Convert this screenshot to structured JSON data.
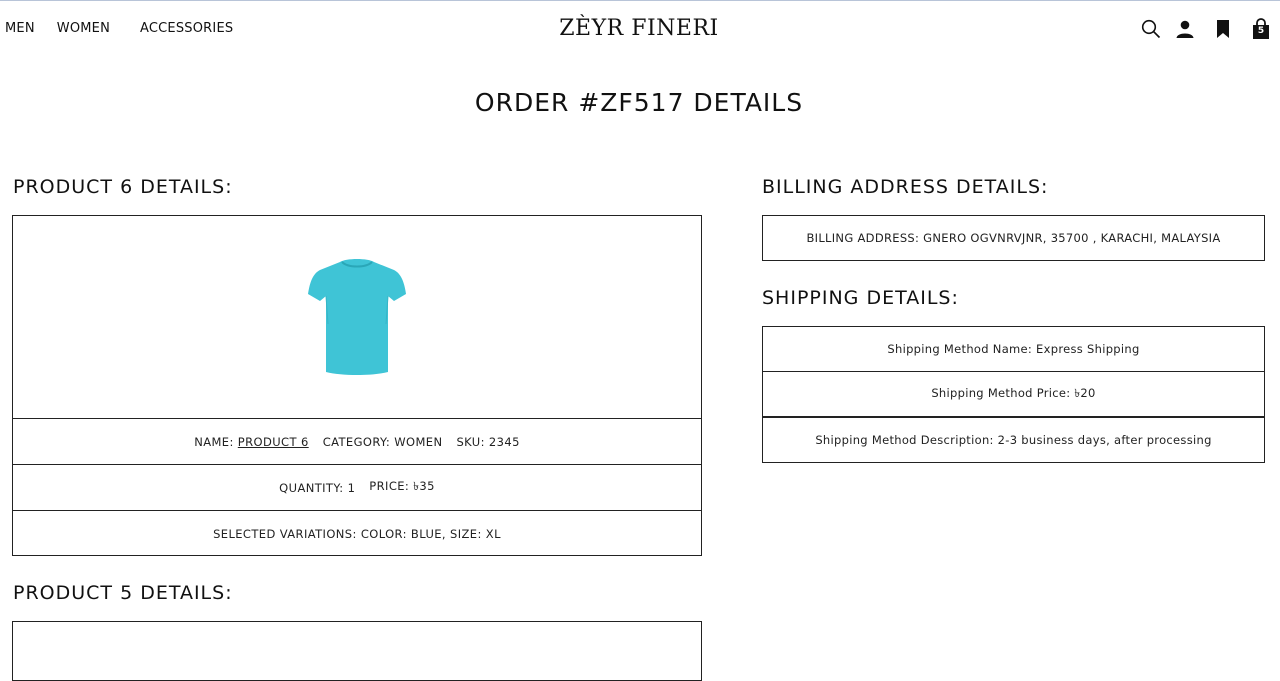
{
  "nav": {
    "men": "MEN",
    "women": "WOMEN",
    "accessories": "ACCESSORIES"
  },
  "brand": "ZÈYR FINERI",
  "header_icons": [
    "search-icon",
    "user-icon",
    "bookmark-icon",
    "shopping-bag-icon"
  ],
  "cart_count": "5",
  "page_title": "ORDER #ZF517 DETAILS",
  "product6": {
    "title": "PRODUCT 6 DETAILS:",
    "name_label": "NAME:",
    "name_value": "PRODUCT 6",
    "category": "CATEGORY: WOMEN",
    "sku": "SKU: 2345",
    "quantity": "QUANTITY: 1",
    "price": "PRICE: ৳35",
    "variations": "SELECTED VARIATIONS: COLOR: BLUE, SIZE: XL",
    "image_color": "#3fc4d6"
  },
  "product5": {
    "title": "PRODUCT 5 DETAILS:"
  },
  "billing": {
    "title": "BILLING ADDRESS DETAILS:",
    "address": "BILLING ADDRESS: GNERO OGVNRVJNR, 35700 , KARACHI, MALAYSIA"
  },
  "shipping": {
    "title": "SHIPPING DETAILS:",
    "method_name": "Shipping Method Name: Express Shipping",
    "method_price": "Shipping Method Price: ৳20",
    "method_description": "Shipping Method Description: 2-3 business days, after processing"
  }
}
